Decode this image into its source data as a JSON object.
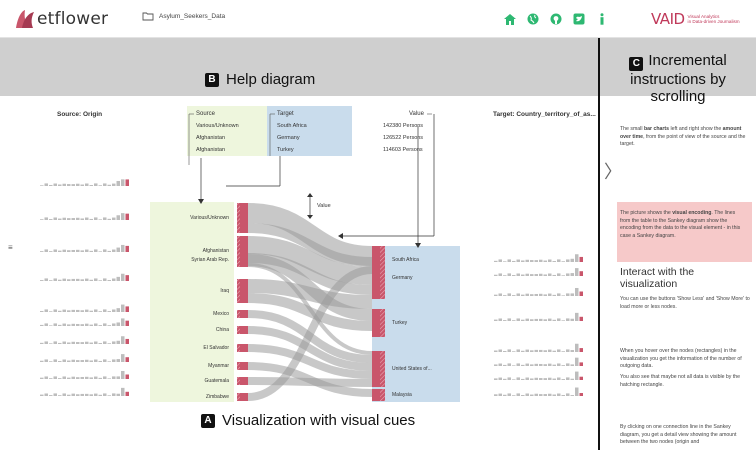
{
  "header": {
    "logo_text": "etflower",
    "dataset_name": "Asylum_Seekers_Data",
    "nav_icons": [
      "home-icon",
      "globe-icon",
      "github-icon",
      "twitter-icon",
      "info-icon"
    ],
    "valid_logo": "VAID",
    "valid_sub_1": "Visual Analytics",
    "valid_sub_2": "in Data-driven Journalism"
  },
  "help": {
    "badge": "B",
    "title": "Help diagram",
    "source_col": "Source",
    "target_col": "Target",
    "value_col": "Value",
    "rows": [
      {
        "source": "Various/Unknown",
        "target": "South Africa",
        "value": "142380 Persons"
      },
      {
        "source": "Afghanistan",
        "target": "Germany",
        "value": "126522 Persons"
      },
      {
        "source": "Afghanistan",
        "target": "Turkey",
        "value": "114603 Persons"
      }
    ]
  },
  "panels": {
    "origin_title": "Source: Origin",
    "target_title": "Target: Country_territory_of_as..."
  },
  "sankey": {
    "value_label": "Value",
    "sources": [
      "Various/Unknown",
      "Afghanistan",
      "Syrian Arab Rep.",
      "Iraq",
      "Mexico",
      "China",
      "El Salvador",
      "Myanmar",
      "Guatemala",
      "Zimbabwe"
    ],
    "targets": [
      "South Africa",
      "Germany",
      "Turkey",
      "United States of...",
      "Malaysia"
    ]
  },
  "caption": {
    "badge": "A",
    "text": "Visualization with visual cues"
  },
  "instructions": {
    "badge": "C",
    "title": "Incremental instructions by scrolling",
    "p1_a": "The small ",
    "p1_b": "bar charts",
    "p1_c": " left and right show the ",
    "p1_d": "amount over time",
    "p1_e": ", from the point of view of the source and the target.",
    "p2_a": "The picture shows the ",
    "p2_b": "visual encoding",
    "p2_c": ". The lines from the table to the Sankey diagram show the encoding from the data to the visual element - in this case a Sankey diagram.",
    "heading": "Interact with the visualization",
    "p3": "You can use the buttons 'Show Less' and 'Show More' to load more or less nodes.",
    "p4": "When you hover over the nodes (rectangles) in the visualization you get the information of the number of outgoing data.",
    "p5": "You also see that maybe not all data is visible by the hatching rectangle.",
    "p6": "By clicking on one connection line in the Sankey diagram, you get a detail view showing the amount between the two nodes (origin and"
  },
  "colors": {
    "node": "#c9566b",
    "source_bg": "#eef6dd",
    "target_bg": "#c9dcec",
    "link": "#9a9a9a",
    "highlight": "#f6c9c9"
  }
}
